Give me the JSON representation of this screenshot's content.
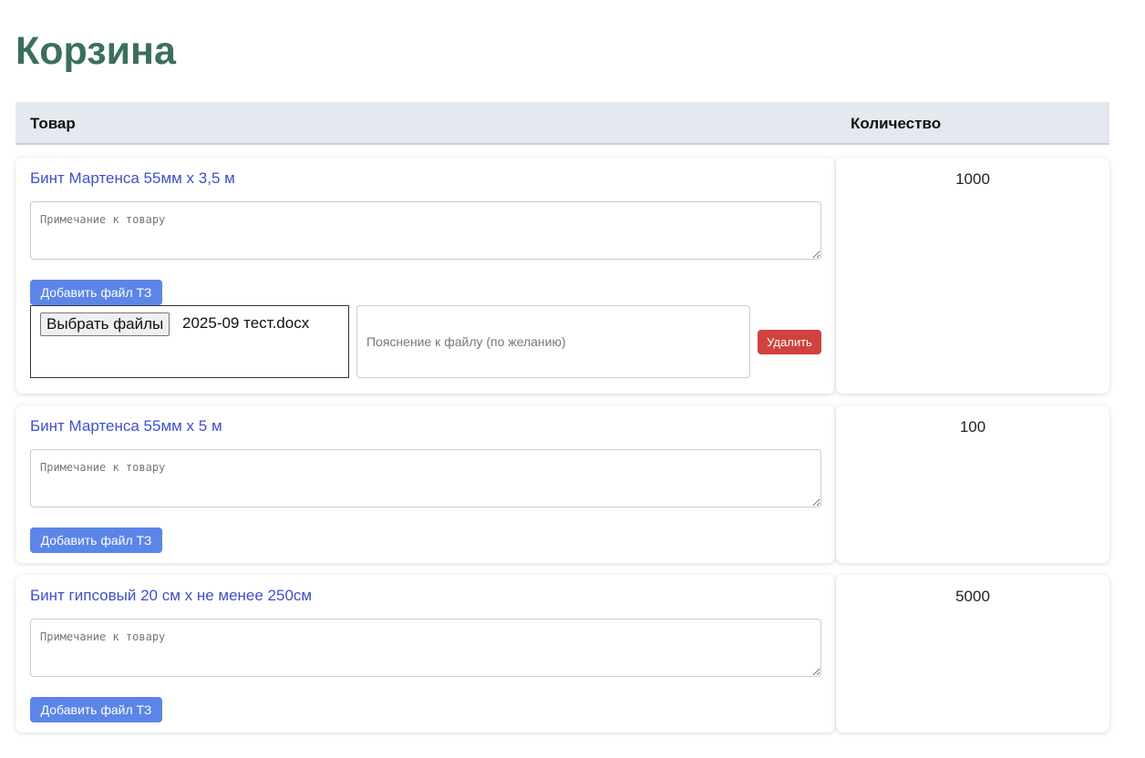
{
  "page": {
    "title": "Корзина"
  },
  "table": {
    "headers": {
      "product": "Товар",
      "quantity": "Количество"
    }
  },
  "items": [
    {
      "name": "Бинт Мартенса 55мм х 3,5 м",
      "note_placeholder": "Примечание к товару",
      "add_file_label": "Добавить файл ТЗ",
      "quantity": "1000",
      "file": {
        "choose_label": "Выбрать файлы",
        "file_name": "2025-09 тест.docx",
        "note_placeholder": "Пояснение к файлу (по желанию)",
        "delete_label": "Удалить"
      }
    },
    {
      "name": "Бинт Мартенса 55мм х 5 м",
      "note_placeholder": "Примечание к товару",
      "add_file_label": "Добавить файл ТЗ",
      "quantity": "100"
    },
    {
      "name": "Бинт гипсовый 20 см х не менее 250см",
      "note_placeholder": "Примечание к товару",
      "add_file_label": "Добавить файл ТЗ",
      "quantity": "5000"
    }
  ],
  "colors": {
    "title": "#3c6e5f",
    "link": "#3f51c6",
    "primary_button": "#5b85e8",
    "danger_button": "#d0423f",
    "header_bg": "#e4e8ef"
  }
}
